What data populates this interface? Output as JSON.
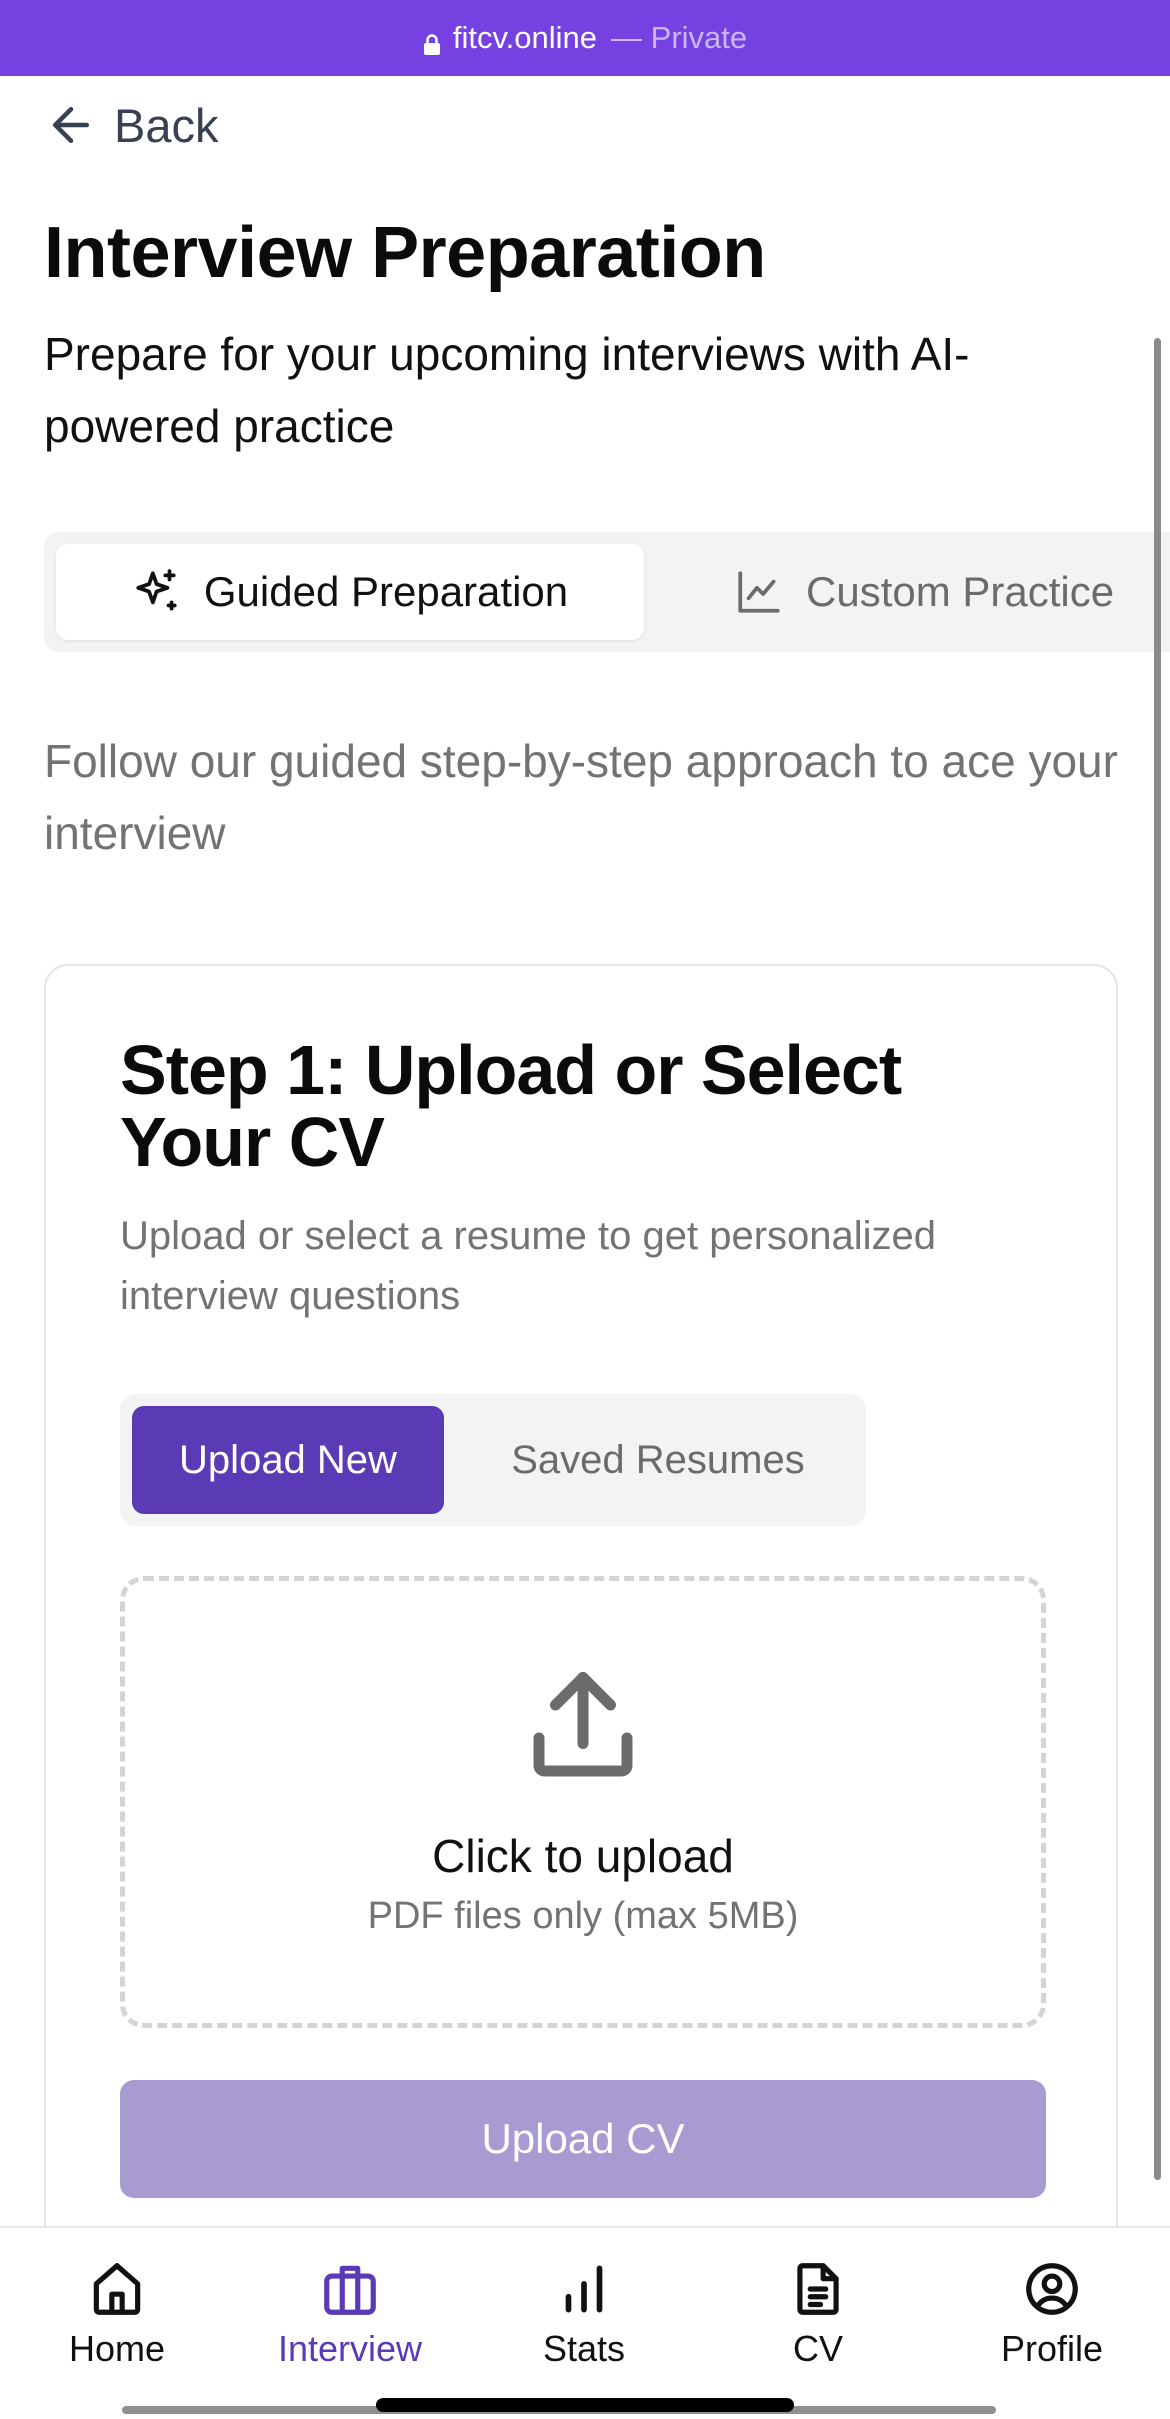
{
  "browser": {
    "domain": "fitcv.online",
    "privacy_label": "— Private",
    "accent_color": "#7541e0"
  },
  "nav": {
    "back_label": "Back"
  },
  "header": {
    "title": "Interview Preparation",
    "subtitle": "Prepare for your upcoming interviews with AI-powered practice"
  },
  "mode_tabs": [
    {
      "label": "Guided Preparation",
      "icon": "sparkles-icon",
      "active": true
    },
    {
      "label": "Custom Practice",
      "icon": "line-chart-icon",
      "active": false
    }
  ],
  "guided_intro": "Follow our guided step-by-step approach to ace your interview",
  "step1": {
    "title": "Step 1: Upload or Select Your CV",
    "description": "Upload or select a resume to get personalized interview questions",
    "tabs": [
      {
        "label": "Upload New",
        "active": true
      },
      {
        "label": "Saved Resumes",
        "active": false
      }
    ],
    "dropzone": {
      "icon": "upload-icon",
      "title": "Click to upload",
      "hint": "PDF files only (max 5MB)"
    },
    "upload_button": "Upload CV",
    "upload_button_color": "#a89bd1",
    "active_color": "#5b3bb5"
  },
  "bottom_nav": [
    {
      "label": "Home",
      "icon": "home-icon",
      "active": false
    },
    {
      "label": "Interview",
      "icon": "briefcase-icon",
      "active": true
    },
    {
      "label": "Stats",
      "icon": "bar-chart-icon",
      "active": false
    },
    {
      "label": "CV",
      "icon": "document-icon",
      "active": false
    },
    {
      "label": "Profile",
      "icon": "user-circle-icon",
      "active": false
    }
  ]
}
